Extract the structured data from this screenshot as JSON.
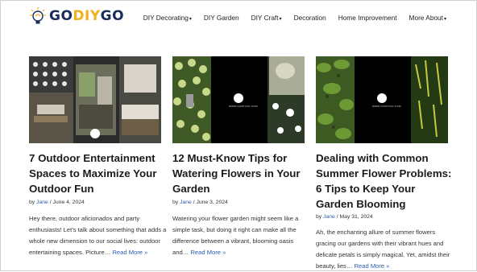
{
  "brand": {
    "part1": "GO",
    "part2": "DIY",
    "part3": "GO"
  },
  "nav": {
    "items": [
      "DIY Decorating",
      "DIY Garden",
      "DIY Craft",
      "Decoration",
      "Home Improvement",
      "More About"
    ]
  },
  "thumb_caption": "WWW.GODIYGO.COM",
  "posts": [
    {
      "title_lines": [
        "7 Outdoor Entertainment",
        "Spaces to Maximize Your",
        "Outdoor Fun"
      ],
      "by": "by",
      "author": "Jane",
      "sep": "/",
      "date": "June 4, 2024",
      "excerpt_lines": [
        "Hey there, outdoor aficionados and party",
        "enthusiasts! Let’s talk about something that adds a",
        "whole new dimension to our social lives: outdoor",
        "entertaining spaces. Picture…"
      ],
      "read_more": "Read More »"
    },
    {
      "title_lines": [
        "12 Must-Know Tips for",
        "Watering Flowers in Your",
        "Garden"
      ],
      "by": "by",
      "author": "Jane",
      "sep": "/",
      "date": "June 3, 2024",
      "excerpt_lines": [
        "Watering your flower garden might seem like a",
        "simple task, but doing it right can make all the",
        "difference between a vibrant, blooming oasis",
        "and…"
      ],
      "read_more": "Read More »"
    },
    {
      "title_lines": [
        "Dealing with Common",
        "Summer Flower Problems:",
        "6 Tips to Keep Your",
        "Garden Blooming"
      ],
      "by": "by",
      "author": "Jane",
      "sep": "/",
      "date": "May 31, 2024",
      "excerpt_lines": [
        "Ah, the enchanting allure of summer flowers",
        "gracing our gardens with their vibrant hues and",
        "delicate petals is simply magical. Yet, amidst their",
        "beauty, lies…"
      ],
      "read_more": "Read More »"
    }
  ]
}
